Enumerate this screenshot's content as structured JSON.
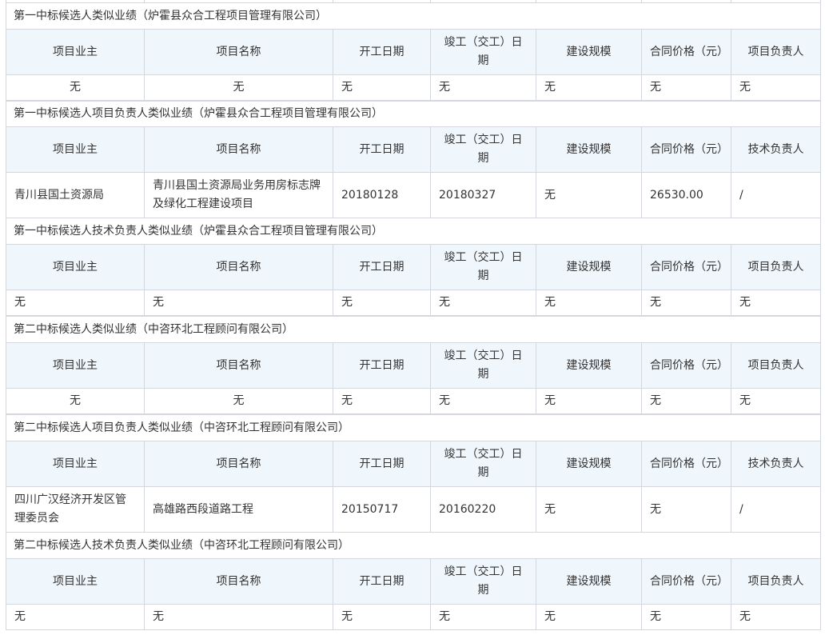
{
  "headers_main": [
    "项目业主",
    "项目名称",
    "开工日期",
    "竣工（交工）日期",
    "建设规模",
    "合同价格（元）",
    "项目负责人"
  ],
  "headers_pm": [
    "项目业主",
    "项目名称",
    "开工日期",
    "竣工（交工）日期",
    "建设规模",
    "合同价格（元）",
    "技术负责人"
  ],
  "sections": [
    {
      "title": "第一中标候选人类似业绩（炉霍县众合工程项目管理有限公司）",
      "header_type": "main",
      "row": [
        "无",
        "无",
        "无",
        "无",
        "无",
        "无",
        "无"
      ]
    },
    {
      "title": "第一中标候选人项目负责人类似业绩（炉霍县众合工程项目管理有限公司）",
      "header_type": "pm",
      "row": [
        "青川县国土资源局",
        "青川县国土资源局业务用房标志牌及绿化工程建设项目",
        "20180128",
        "20180327",
        "无",
        "26530.00",
        "/"
      ]
    },
    {
      "title": "第一中标候选人技术负责人类似业绩（炉霍县众合工程项目管理有限公司）",
      "header_type": "main",
      "row": [
        "无",
        "无",
        "无",
        "无",
        "无",
        "无",
        "无"
      ]
    },
    {
      "title": "第二中标候选人类似业绩（中咨环北工程顾问有限公司）",
      "header_type": "main",
      "row": [
        "无",
        "无",
        "无",
        "无",
        "无",
        "无",
        "无"
      ]
    },
    {
      "title": "第二中标候选人项目负责人类似业绩（中咨环北工程顾问有限公司）",
      "header_type": "pm",
      "row": [
        "四川广汉经济开发区管理委员会",
        "高雄路西段道路工程",
        "20150717",
        "20160220",
        "无",
        "无",
        "/"
      ]
    },
    {
      "title": "第二中标候选人技术负责人类似业绩（中咨环北工程顾问有限公司）",
      "header_type": "main",
      "row": [
        "无",
        "无",
        "无",
        "无",
        "无",
        "无",
        "无"
      ]
    }
  ]
}
